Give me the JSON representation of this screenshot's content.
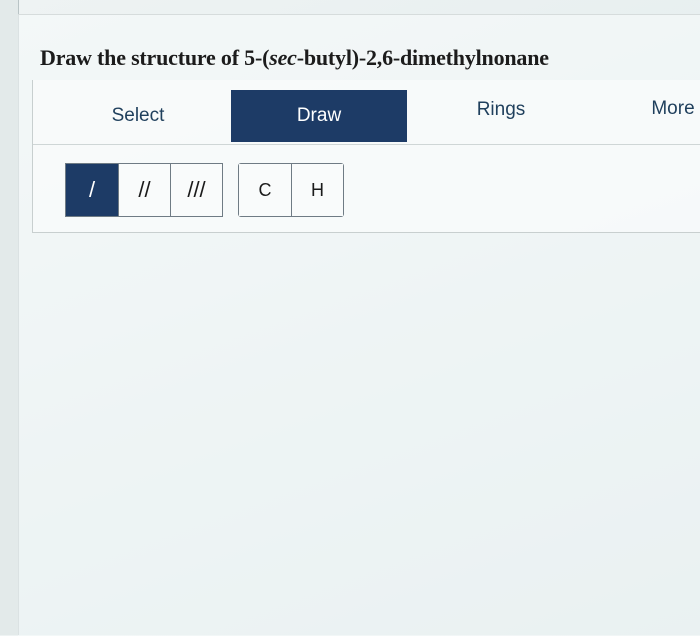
{
  "question": {
    "prefix": "Draw the structure of 5-(",
    "italic": "sec",
    "suffix": "-butyl)-2,6-dimethylnonane"
  },
  "tabs": [
    {
      "label": "Select",
      "active": false
    },
    {
      "label": "Draw",
      "active": true
    },
    {
      "label": "Rings",
      "active": false
    },
    {
      "label": "More",
      "active": false
    }
  ],
  "bond_tools": [
    {
      "label": "/",
      "icon": "single-bond-icon",
      "active": true
    },
    {
      "label": "//",
      "icon": "double-bond-icon",
      "active": false
    },
    {
      "label": "///",
      "icon": "triple-bond-icon",
      "active": false
    }
  ],
  "atom_tools": [
    {
      "label": "C"
    },
    {
      "label": "H"
    }
  ],
  "colors": {
    "active_accent": "#1d3b66",
    "tab_text": "#1f3f5c",
    "title_text": "#1c1c1c"
  }
}
